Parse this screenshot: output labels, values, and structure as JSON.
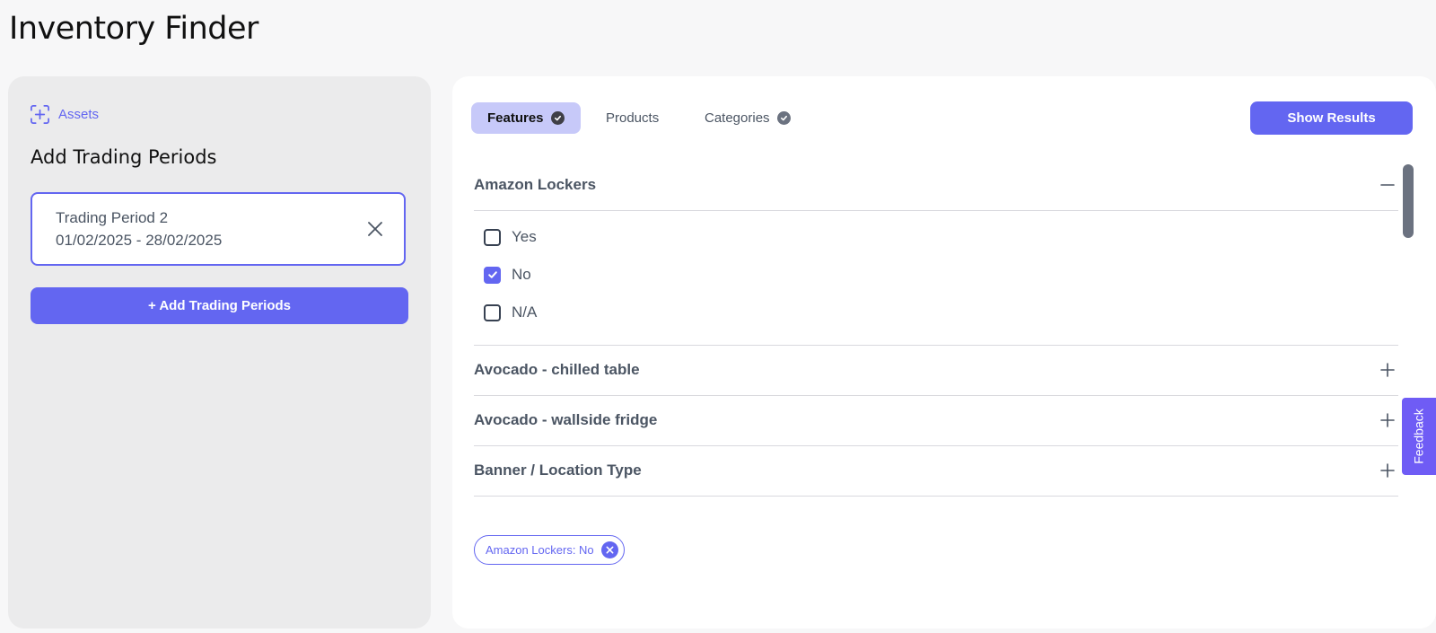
{
  "page": {
    "title": "Inventory Finder"
  },
  "left": {
    "assets_label": "Assets",
    "heading": "Add Trading Periods",
    "period": {
      "name": "Trading Period 2",
      "dates": "01/02/2025 - 28/02/2025"
    },
    "add_button": "+ Add Trading Periods"
  },
  "tabs": [
    {
      "label": "Features",
      "active": true,
      "checked": true
    },
    {
      "label": "Products",
      "active": false,
      "checked": false
    },
    {
      "label": "Categories",
      "active": false,
      "checked": true
    }
  ],
  "show_results": "Show Results",
  "accordion": [
    {
      "title": "Amazon Lockers",
      "expanded": true,
      "options": [
        {
          "label": "Yes",
          "checked": false
        },
        {
          "label": "No",
          "checked": true
        },
        {
          "label": "N/A",
          "checked": false
        }
      ]
    },
    {
      "title": "Avocado - chilled table",
      "expanded": false
    },
    {
      "title": "Avocado - wallside fridge",
      "expanded": false
    },
    {
      "title": "Banner / Location Type",
      "expanded": false
    }
  ],
  "selected_filters": [
    {
      "label": "Amazon Lockers: No"
    }
  ],
  "feedback": "Feedback",
  "colors": {
    "accent": "#6366f1",
    "accent_soft": "#c7c9f9",
    "panel_bg": "#ebebec"
  }
}
